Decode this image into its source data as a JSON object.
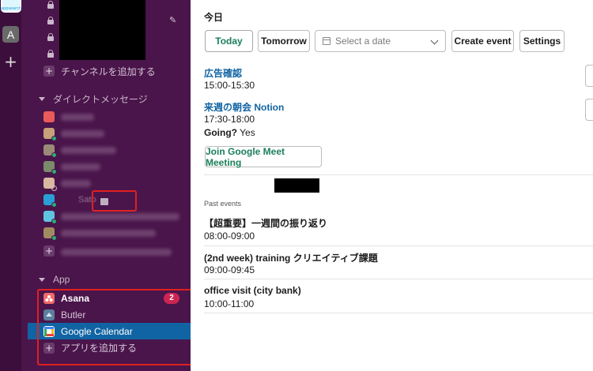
{
  "rail": {
    "workspace_top_label": "appsearch",
    "workspace_a": "A",
    "add_symbol": "+"
  },
  "sidebar": {
    "add_channel_label": "チャンネルを追加する",
    "dm_section_label": "ダイレクトメッセージ",
    "dm_visible_name_fragment": "Sato",
    "app_section_label": "App",
    "apps": [
      {
        "label": "Asana",
        "badge": "2",
        "icon": "asana-icon",
        "color": "#f06a6a"
      },
      {
        "label": "Butler",
        "icon": "butler-icon",
        "color": "#5b7fa0"
      },
      {
        "label": "Google Calendar",
        "icon": "google-calendar-icon",
        "color": "#4285f4",
        "selected": true
      },
      {
        "label": "アプリを追加する",
        "icon": "plus-icon"
      }
    ],
    "colors": {
      "bg": "#4a154b",
      "selected": "#1164a3",
      "badge": "#cd2553"
    }
  },
  "main": {
    "heading": "今日",
    "toolbar": {
      "today": "Today",
      "tomorrow": "Tomorrow",
      "date_placeholder": "Select a date",
      "create_event": "Create event",
      "settings": "Settings"
    },
    "events": [
      {
        "title": "広告確認",
        "time": "15:00-15:30"
      },
      {
        "title": "来週の朝会 Notion",
        "time": "17:30-18:00",
        "going_label": "Going?",
        "going_value": "Yes",
        "meet_button": "Join Google Meet Meeting"
      }
    ],
    "past_label": "Past events",
    "past_events": [
      {
        "title": "【超重要】一週間の振り返り",
        "time": "08:00-09:00"
      },
      {
        "title": "(2nd  week) training クリエイティブ課題",
        "time": "09:00-09:45"
      },
      {
        "title": "office visit (city bank)",
        "time": "10:00-11:00"
      }
    ],
    "colors": {
      "link": "#1264a3",
      "green": "#1a7f5a"
    }
  }
}
